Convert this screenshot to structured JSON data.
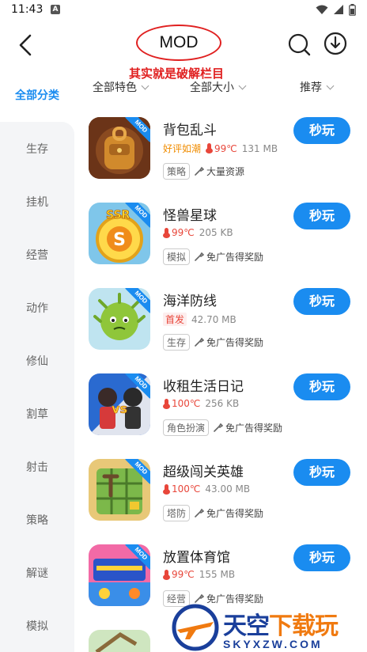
{
  "status_bar": {
    "time": "11:43",
    "notif_letter": "A"
  },
  "header": {
    "title": "MOD",
    "annotation": "其实就是破解栏目"
  },
  "icons": [
    "back-icon",
    "search-icon",
    "download-icon",
    "wifi-icon",
    "signal-icon",
    "battery-icon",
    "wrench-icon",
    "thermometer-icon"
  ],
  "colors": {
    "accent": "#1a8cf0",
    "annotation_red": "#e02020",
    "hot_red": "#e8463a",
    "good_orange": "#f08c00",
    "sidebar_bg": "#f4f5f7"
  },
  "sidebar": {
    "active": "全部分类",
    "items": [
      "生存",
      "挂机",
      "经营",
      "动作",
      "修仙",
      "割草",
      "射击",
      "策略",
      "解谜",
      "模拟"
    ]
  },
  "filters": {
    "feature": "全部特色",
    "size": "全部大小",
    "sort": "推荐"
  },
  "games": [
    {
      "name": "背包乱斗",
      "label": "好评如潮",
      "heat": "99℃",
      "size": "131 MB",
      "genre": "策略",
      "feature": "大量资源",
      "button": "秒玩",
      "mod": "MOD"
    },
    {
      "name": "怪兽星球",
      "label": "",
      "heat": "99℃",
      "size": "205 KB",
      "genre": "模拟",
      "feature": "免广告得奖励",
      "button": "秒玩",
      "mod": "MOD"
    },
    {
      "name": "海洋防线",
      "label": "首发",
      "heat": "",
      "size": "42.70 MB",
      "genre": "生存",
      "feature": "免广告得奖励",
      "button": "秒玩",
      "mod": "MOD"
    },
    {
      "name": "收租生活日记",
      "label": "",
      "heat": "100℃",
      "size": "256 KB",
      "genre": "角色扮演",
      "feature": "免广告得奖励",
      "button": "秒玩",
      "mod": "MOD"
    },
    {
      "name": "超级闯关英雄",
      "label": "",
      "heat": "100℃",
      "size": "43.00 MB",
      "genre": "塔防",
      "feature": "免广告得奖励",
      "button": "秒玩",
      "mod": "MOD"
    },
    {
      "name": "放置体育馆",
      "label": "",
      "heat": "99℃",
      "size": "155 MB",
      "genre": "经营",
      "feature": "免广告得奖励",
      "button": "秒玩",
      "mod": "MOD"
    }
  ],
  "watermark": {
    "main_a": "天空",
    "main_b": "下载玩",
    "sub": "SKYXZW.COM"
  }
}
